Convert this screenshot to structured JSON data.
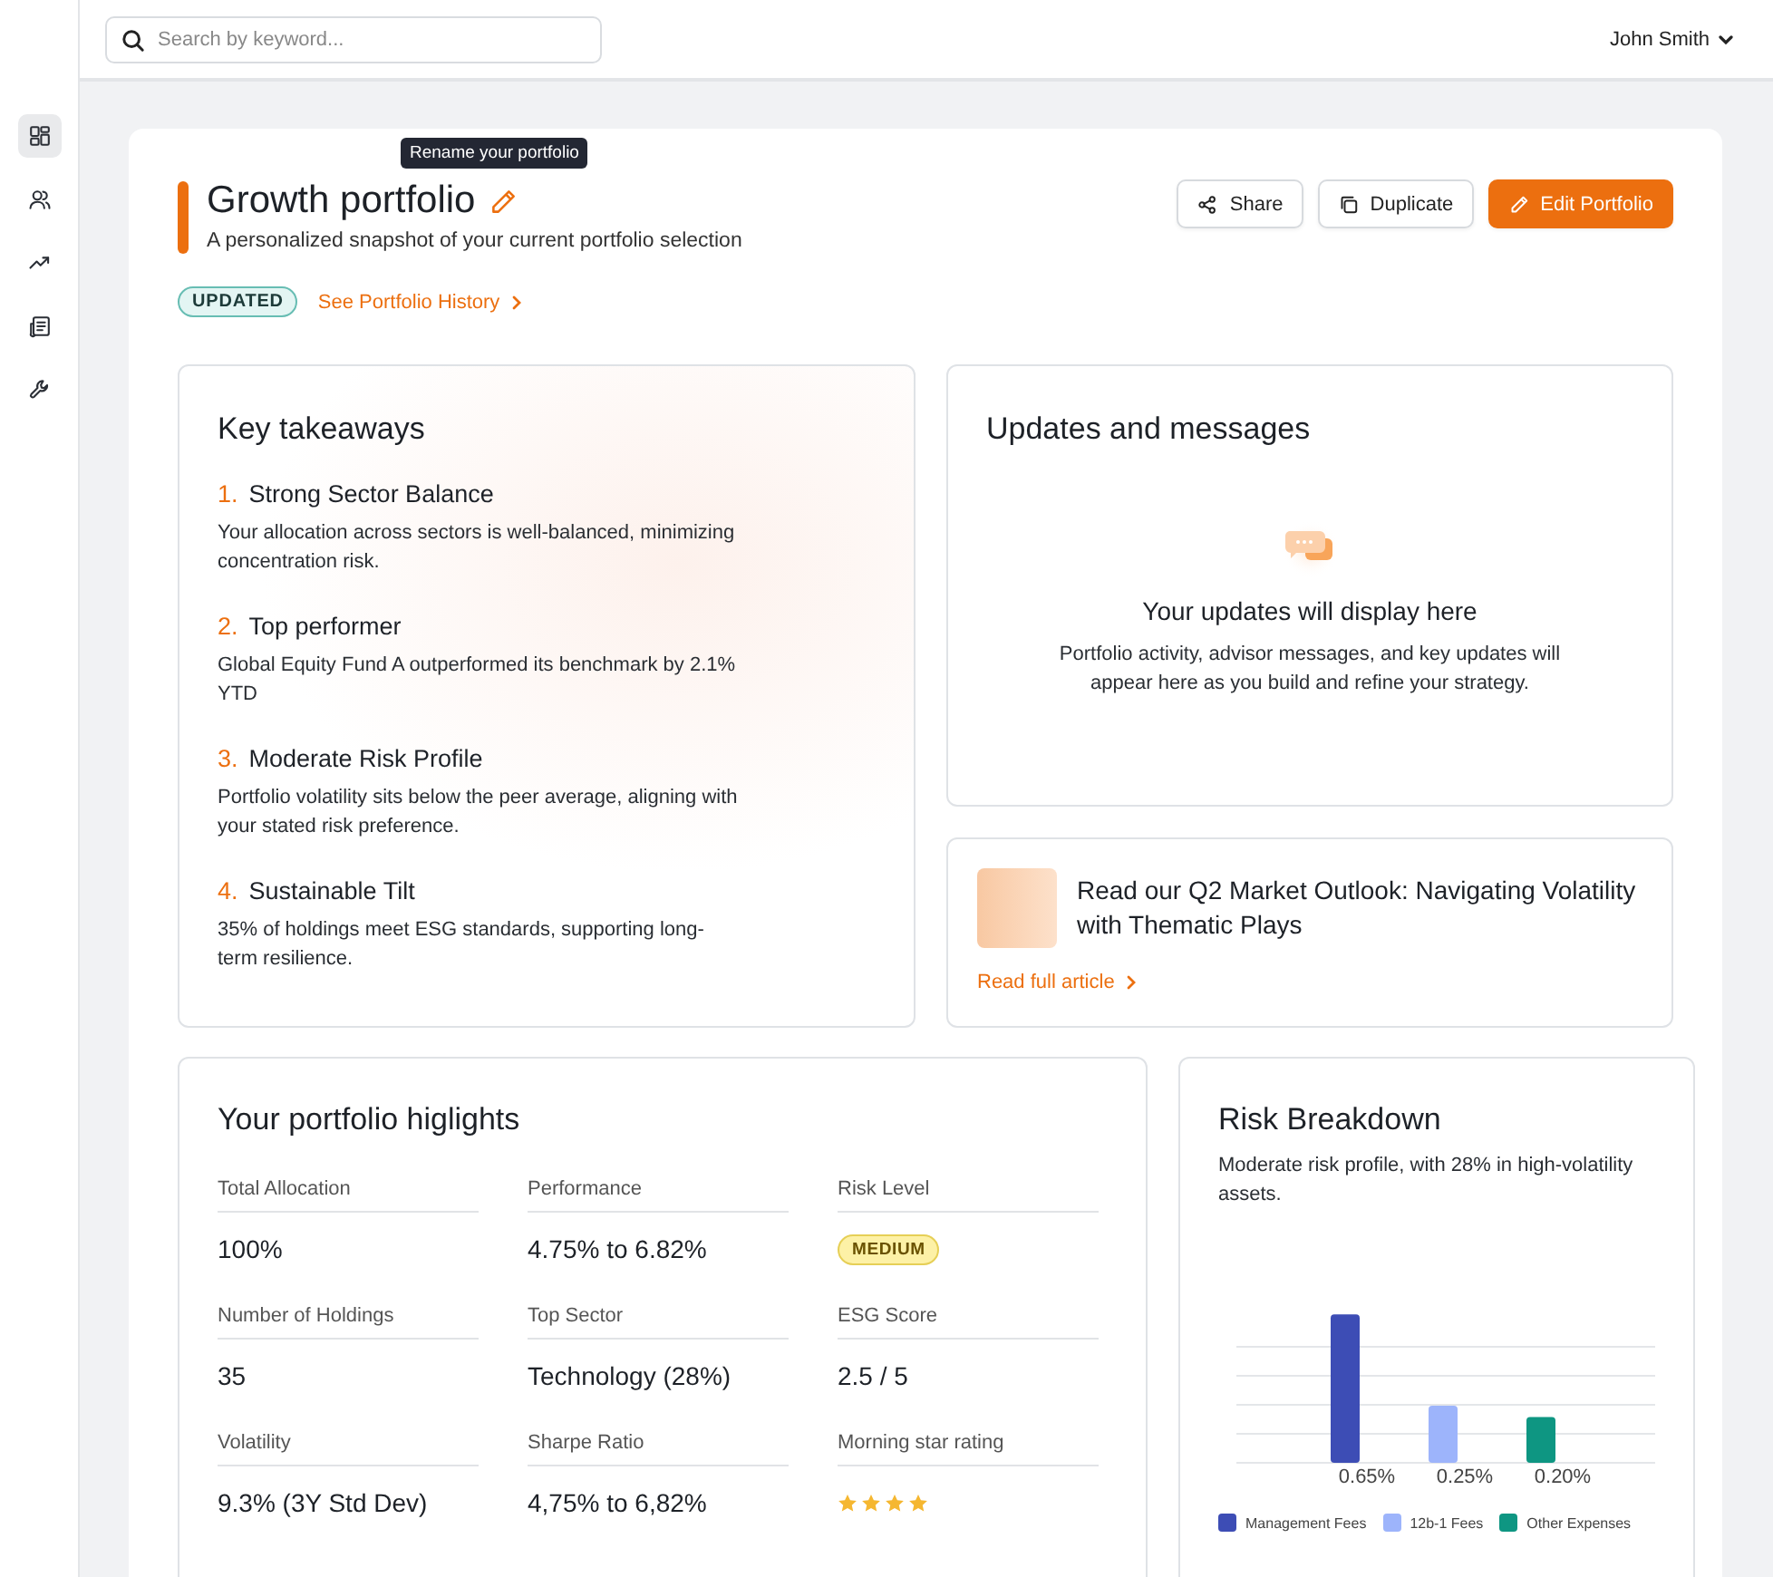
{
  "sidebar": {
    "items": [
      {
        "selected": true
      },
      {
        "selected": false
      },
      {
        "selected": false
      },
      {
        "selected": false
      },
      {
        "selected": false
      }
    ]
  },
  "topbar": {
    "search": {
      "placeholder": "Search by keyword..."
    },
    "user": "John Smith"
  },
  "header": {
    "tooltip": "Rename your portfolio",
    "title": "Growth portfolio",
    "subtitle": "A personalized snapshot of your current portfolio selection",
    "badge": "UPDATED",
    "history_link": "See Portfolio History",
    "actions": [
      {
        "label": "Share",
        "kind": "share",
        "primary": false
      },
      {
        "label": "Duplicate",
        "kind": "duplicate",
        "primary": false
      },
      {
        "label": "Edit Portfolio",
        "kind": "edit",
        "primary": true
      }
    ]
  },
  "takeaways": {
    "title": "Key takeaways",
    "items": [
      {
        "number": "1.",
        "title": "Strong Sector Balance",
        "text": "Your allocation across sectors is well-balanced, minimizing concentration risk."
      },
      {
        "number": "2.",
        "title": "Top performer",
        "text": "Global Equity Fund A outperformed its benchmark by 2.1% YTD"
      },
      {
        "number": "3.",
        "title": "Moderate Risk Profile",
        "text": "Portfolio volatility sits below the peer average, aligning with your stated risk preference."
      },
      {
        "number": "4.",
        "title": "Sustainable Tilt",
        "text": "35% of holdings meet ESG standards, supporting long-term resilience."
      }
    ]
  },
  "updates": {
    "title": "Updates and messages",
    "empty_title": "Your updates will display here",
    "empty_text": "Portfolio activity, advisor messages, and key updates will appear here as you build and refine your strategy."
  },
  "article": {
    "title": "Read our Q2 Market Outlook: Navigating Volatility with Thematic Plays",
    "link": "Read full article"
  },
  "highlights": {
    "title": "Your portfolio higlights",
    "items": [
      {
        "label": "Total Allocation",
        "kind": "text",
        "value": "100%"
      },
      {
        "label": "Performance",
        "kind": "text",
        "value": "4.75% to 6.82%"
      },
      {
        "label": "Risk Level",
        "kind": "badge",
        "value": "MEDIUM"
      },
      {
        "label": "Number of Holdings",
        "kind": "text",
        "value": "35"
      },
      {
        "label": "Top Sector",
        "kind": "text",
        "value": "Technology (28%)"
      },
      {
        "label": "ESG Score",
        "kind": "text",
        "value": "2.5 / 5"
      },
      {
        "label": "Volatility",
        "kind": "text",
        "value": "9.3% (3Y Std Dev)"
      },
      {
        "label": "Sharpe Ratio",
        "kind": "text",
        "value": "4,75% to 6,82%"
      },
      {
        "label": "Morning star rating",
        "kind": "stars",
        "stars": 4
      }
    ]
  },
  "risk": {
    "title": "Risk Breakdown",
    "text": "Moderate risk profile, with 28% in high-volatility assets.",
    "chart_data": {
      "type": "bar",
      "stacked": true,
      "legend": "bottom",
      "series": [
        {
          "name": "Management Fees",
          "color": "#3d4db5",
          "values": [
            0.65,
            null,
            null
          ],
          "value_labels": [
            "0.65%",
            null,
            null
          ]
        },
        {
          "name": "12b-1 Fees",
          "color": "#9db4fb",
          "values": [
            null,
            0.25,
            null
          ],
          "value_labels": [
            null,
            "0.25%",
            null
          ]
        },
        {
          "name": "Other Expenses",
          "color": "#0e9682",
          "values": [
            null,
            null,
            0.2
          ],
          "value_labels": [
            null,
            null,
            "0.20%"
          ]
        }
      ]
    }
  }
}
